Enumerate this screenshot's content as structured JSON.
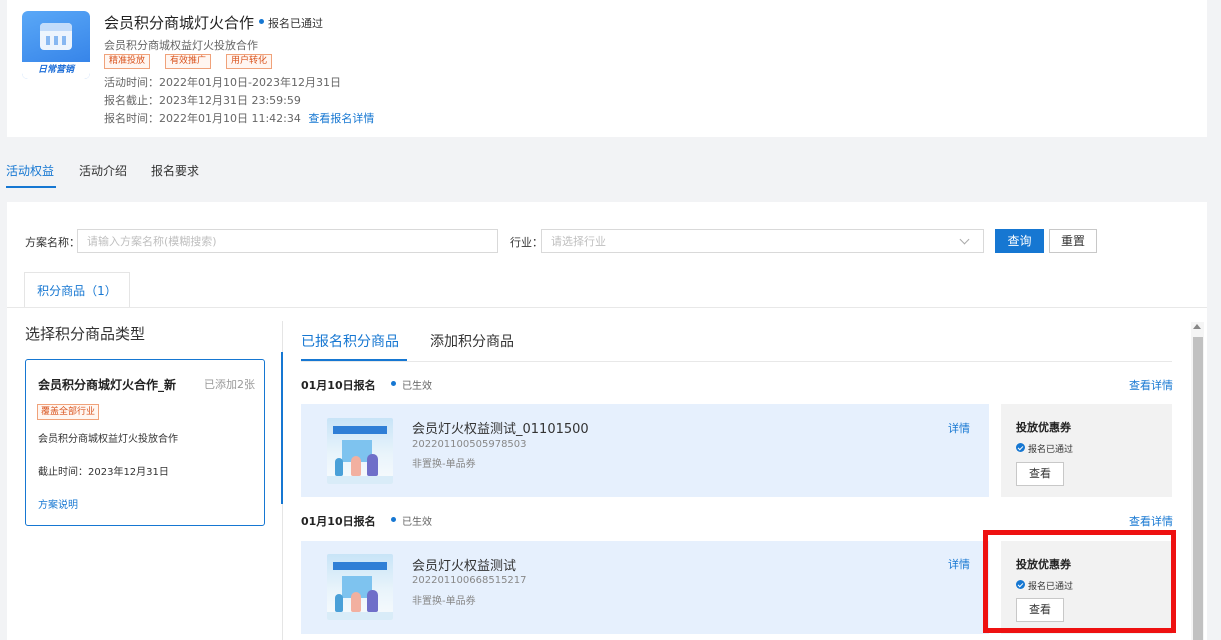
{
  "header": {
    "logo_text": "日常营销",
    "title": "会员积分商城灯火合作",
    "status": "报名已通过",
    "subtitle": "会员积分商城权益灯火投放合作",
    "tags": [
      "精准投放",
      "有效推广",
      "用户转化"
    ],
    "activity_time": "活动时间：2022年01月10日-2023年12月31日",
    "signup_deadline": "报名截止：2023年12月31日 23:59:59",
    "signup_time": "报名时间：2022年01月10日 11:42:34",
    "signup_detail_link": "查看报名详情"
  },
  "top_tabs": [
    "活动权益",
    "活动介绍",
    "报名要求"
  ],
  "filter": {
    "scheme_label": "方案名称：",
    "scheme_placeholder": "请输入方案名称(模糊搜索)",
    "industry_label": "行业：",
    "industry_placeholder": "请选择行业",
    "search_button": "查询",
    "reset_button": "重置"
  },
  "product_tab": "积分商品（1）",
  "left_panel": {
    "title": "选择积分商品类型",
    "scheme": {
      "name": "会员积分商城灯火合作_新",
      "added": "已添加2张",
      "tag": "覆盖全部行业",
      "desc": "会员积分商城权益灯火投放合作",
      "deadline": "截止时间：2023年12月31日",
      "link": "方案说明"
    }
  },
  "right_tabs": [
    "已报名积分商品",
    "添加积分商品"
  ],
  "sections": [
    {
      "date": "01月10日报名",
      "status": "已生效",
      "link": "查看详情",
      "product": {
        "name": "会员灯火权益测试_01101500",
        "id": "2022011005059785​03",
        "type": "非置换-单品券",
        "detail": "详情"
      },
      "coupon": {
        "title": "投放优惠券",
        "status": "报名已通过",
        "button": "查看"
      }
    },
    {
      "date": "01月10日报名",
      "status": "已生效",
      "link": "查看详情",
      "product": {
        "name": "会员灯火权益测试",
        "id": "202201100668515217",
        "type": "非置换-单品券",
        "detail": "详情"
      },
      "coupon": {
        "title": "投放优惠券",
        "status": "报名已通过",
        "button": "查看"
      }
    }
  ],
  "colors": {
    "accent": "#1677d2",
    "tag_text": "#d9541e",
    "highlight": "#ee1111",
    "product_bg": "#e6f0fd"
  }
}
